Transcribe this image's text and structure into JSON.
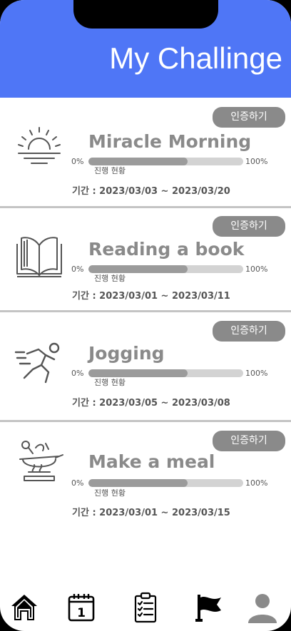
{
  "header": {
    "title": "My Challinge"
  },
  "progress_start_label": "0%",
  "progress_end_label": "100%",
  "progress_caption": "진행 현황",
  "cert_button_label": "인증하기",
  "challenges": [
    {
      "title": "Miracle Morning",
      "icon": "sunrise-icon",
      "progress": 0.64,
      "period": "기간 : 2023/03/03 ~ 2023/03/20"
    },
    {
      "title": "Reading a book",
      "icon": "book-icon",
      "progress": 0.64,
      "period": "기간 : 2023/03/01 ~ 2023/03/11"
    },
    {
      "title": "Jogging",
      "icon": "running-icon",
      "progress": 0.64,
      "period": "기간 : 2023/03/05 ~ 2023/03/08"
    },
    {
      "title": "Make a meal",
      "icon": "cooking-icon",
      "progress": 0.64,
      "period": "기간 : 2023/03/01 ~ 2023/03/15"
    }
  ],
  "nav": [
    {
      "icon": "home-icon"
    },
    {
      "icon": "calendar-icon",
      "label": "1"
    },
    {
      "icon": "clipboard-checklist-icon"
    },
    {
      "icon": "flag-icon"
    },
    {
      "icon": "user-profile-icon"
    }
  ],
  "colors": {
    "header": "#4F76F6",
    "button": "#8a8a8a",
    "track": "#d3d3d3",
    "fill": "#9b9b9b"
  }
}
